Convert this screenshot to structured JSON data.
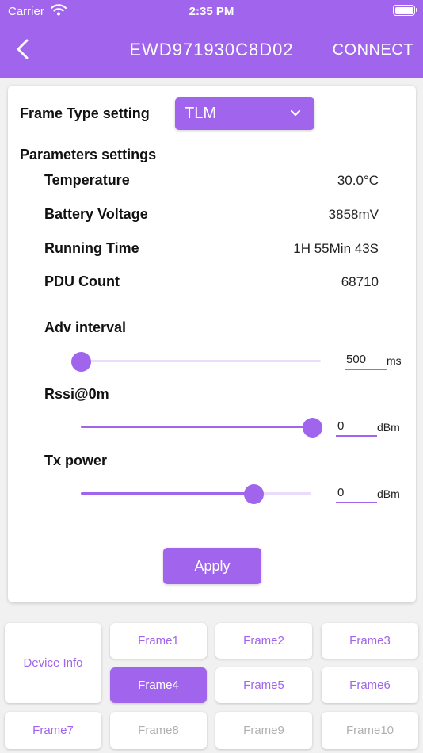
{
  "status_bar": {
    "carrier": "Carrier",
    "time": "2:35 PM"
  },
  "header": {
    "title": "EWD971930C8D02",
    "connect_label": "CONNECT"
  },
  "frame_type": {
    "label": "Frame Type setting",
    "value": "TLM"
  },
  "parameters": {
    "heading": "Parameters settings",
    "rows": [
      {
        "label": "Temperature",
        "value": "30.0°C"
      },
      {
        "label": "Battery Voltage",
        "value": "3858mV"
      },
      {
        "label": "Running Time",
        "value": "1H 55Min 43S"
      },
      {
        "label": "PDU Count",
        "value": "68710"
      }
    ]
  },
  "sliders": [
    {
      "label": "Adv interval",
      "value": "500",
      "unit": "ms",
      "level": 0.0
    },
    {
      "label": "Rssi@0m",
      "value": "0",
      "unit": "dBm",
      "level": 1.0
    },
    {
      "label": "Tx power",
      "value": "0",
      "unit": "dBm",
      "level": 0.75
    }
  ],
  "apply_label": "Apply",
  "tabs": {
    "device_info": "Device Info",
    "frames": [
      {
        "label": "Frame1",
        "state": "normal"
      },
      {
        "label": "Frame2",
        "state": "normal"
      },
      {
        "label": "Frame3",
        "state": "normal"
      },
      {
        "label": "Frame4",
        "state": "selected"
      },
      {
        "label": "Frame5",
        "state": "normal"
      },
      {
        "label": "Frame6",
        "state": "normal"
      },
      {
        "label": "Frame7",
        "state": "normal"
      },
      {
        "label": "Frame8",
        "state": "disabled"
      },
      {
        "label": "Frame9",
        "state": "disabled"
      },
      {
        "label": "Frame10",
        "state": "disabled"
      }
    ]
  },
  "colors": {
    "accent": "#a065ec",
    "track": "#eadcfb",
    "disabled_text": "#b0b0b0"
  }
}
